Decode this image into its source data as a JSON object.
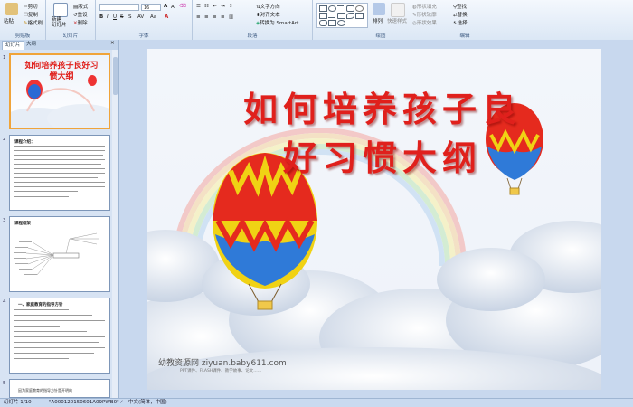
{
  "ribbon": {
    "clipboard": {
      "label": "剪贴板",
      "paste": "粘贴",
      "cut": "剪切",
      "copy": "复制",
      "format_painter": "格式刷"
    },
    "slides": {
      "label": "幻灯片",
      "new_slide": "新建\n幻灯片",
      "layout": "版式",
      "reset": "重设",
      "delete": "删除"
    },
    "font": {
      "label": "字体",
      "font_name": "",
      "font_size": "16"
    },
    "paragraph": {
      "label": "段落",
      "text_direction": "文字方向",
      "align_text": "对齐文本",
      "smartart": "转换为 SmartArt"
    },
    "drawing": {
      "label": "绘图",
      "arrange": "排列",
      "quick_styles": "快速样式",
      "shape_fill": "形状填充",
      "shape_outline": "形状轮廓",
      "shape_effects": "形状效果"
    },
    "editing": {
      "label": "编辑",
      "find": "查找",
      "replace": "替换",
      "select": "选择"
    }
  },
  "sidepanel": {
    "tabs": [
      "幻灯片",
      "大纲"
    ],
    "thumbs": [
      {
        "num": "1",
        "title": "如何培养孩子良好习惯大纲"
      },
      {
        "num": "2",
        "heading": "课程介绍："
      },
      {
        "num": "3",
        "heading": "课程框架"
      },
      {
        "num": "4",
        "heading": "一、家庭教育的指导方针"
      },
      {
        "num": "5",
        "heading": ""
      }
    ],
    "partial_thumb_text": "因为家庭教育的指导方针是开明的"
  },
  "slide": {
    "title_line1": "如何培养孩子良",
    "title_line2": "好习惯大纲",
    "watermark": "幼教资源网 ziyuan.baby611.com",
    "watermark_sub": "PPT课件、FLASH课件、教学故事、论文……"
  },
  "status": {
    "slide_pos": "幻灯片 1/10",
    "theme": "\"A000120150601A09PWB0\"",
    "language": "中文(简体，中国)"
  },
  "colors": {
    "title_red": "#e0201c",
    "ribbon_bg": "#dbe7f5",
    "selected_border": "#f0a43a"
  }
}
